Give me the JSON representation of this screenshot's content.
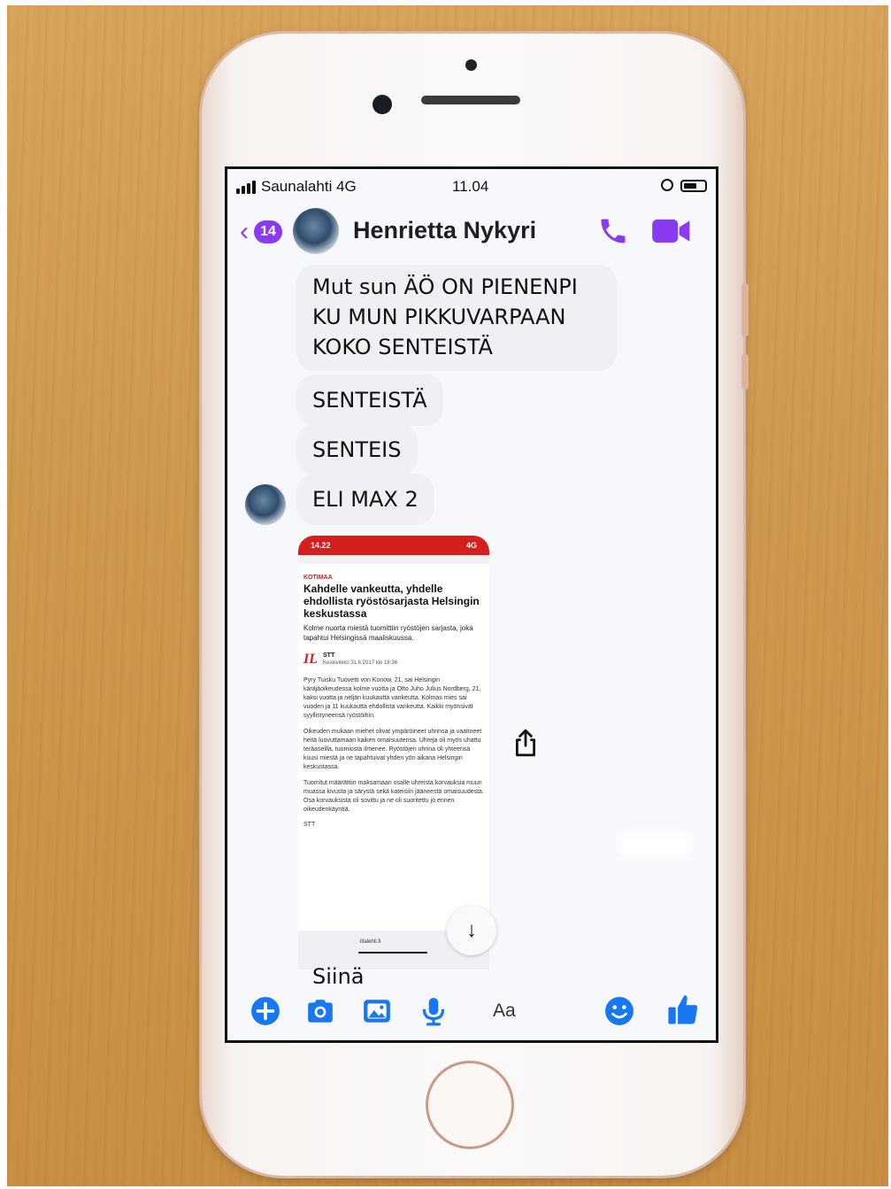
{
  "status_bar": {
    "carrier": "Saunalahti  4G",
    "time": "11.04"
  },
  "header": {
    "back_badge": "14",
    "contact_name": "Henrietta Nykyri"
  },
  "messages": [
    {
      "text": "Mut sun ÄÖ ON PIENENPI KU MUN PIKKUVARPAAN KOKO SENTEISTÄ"
    },
    {
      "text": "SENTEISTÄ"
    },
    {
      "text": "SENTEIS"
    },
    {
      "text": "ELI MAX 2"
    }
  ],
  "shared_screenshot": {
    "time": "14.22",
    "status": "4G",
    "category": "KOTIMAA",
    "headline": "Kahdelle vankeutta, yhdelle ehdollista ryöstösarjasta Helsingin keskustassa",
    "lead": "Kolme nuorta miestä tuomittiin ryöstöjen sarjasta, joka tapahtui Helsingissä maaliskuussa.",
    "publisher_logo": "IL",
    "byline_author": "STT",
    "byline_date": "Keskiviikko 31.6.2017 klo 18:36",
    "paragraphs": [
      "Pyry Tuisku Tuovetti von Konow, 21, sai Helsingin käräjäoikeudessa kolme vuotta ja Otto Juho Julius Nordberg, 21, kaksi vuotta ja neljän kuukautta vankeutta. Kolmas mies sai vuoden ja 11 kuukautta ehdollista vankeutta. Kaikki myönsivät syyllistyneensä ryöstöihin.",
      "Oikeuden mukaan miehet olivat ympäröineet uhrinsa ja vaatineet heitä luovuttamaan kaiken omaisuutensa. Uhreja oli myös uhattu teräaseilla, tuomiosta ilmenee. Ryöstöjen uhrina oli yhteensä kuusi miestä ja ne tapahtuivat yhden yön aikana Helsingin keskustassa.",
      "Tuomitut määrättiin maksamaan osalle uhreista korvauksia muun muassa kivusta ja särystä sekä kateisiin jääneestä omaisuudesta. Osa korvauksista oli sovittu ja ne oli suoritettu jo ennen oikeudenkäyntiä."
    ],
    "source": "STT",
    "url": "iltalehti.fi"
  },
  "partial_message": "Siinä",
  "composer": {
    "placeholder": "Aa"
  },
  "colors": {
    "accent": "#8a3bf2",
    "composer_blue": "#1877f2",
    "newspaper_red": "#d51f1f"
  },
  "icons": {
    "call": "phone-icon",
    "video": "video-camera-icon",
    "plus": "plus-circle-icon",
    "camera": "camera-icon",
    "gallery": "image-icon",
    "mic": "microphone-icon",
    "emoji": "smiley-icon",
    "like": "thumbs-up-icon",
    "share": "share-icon",
    "scroll": "arrow-down-icon"
  }
}
